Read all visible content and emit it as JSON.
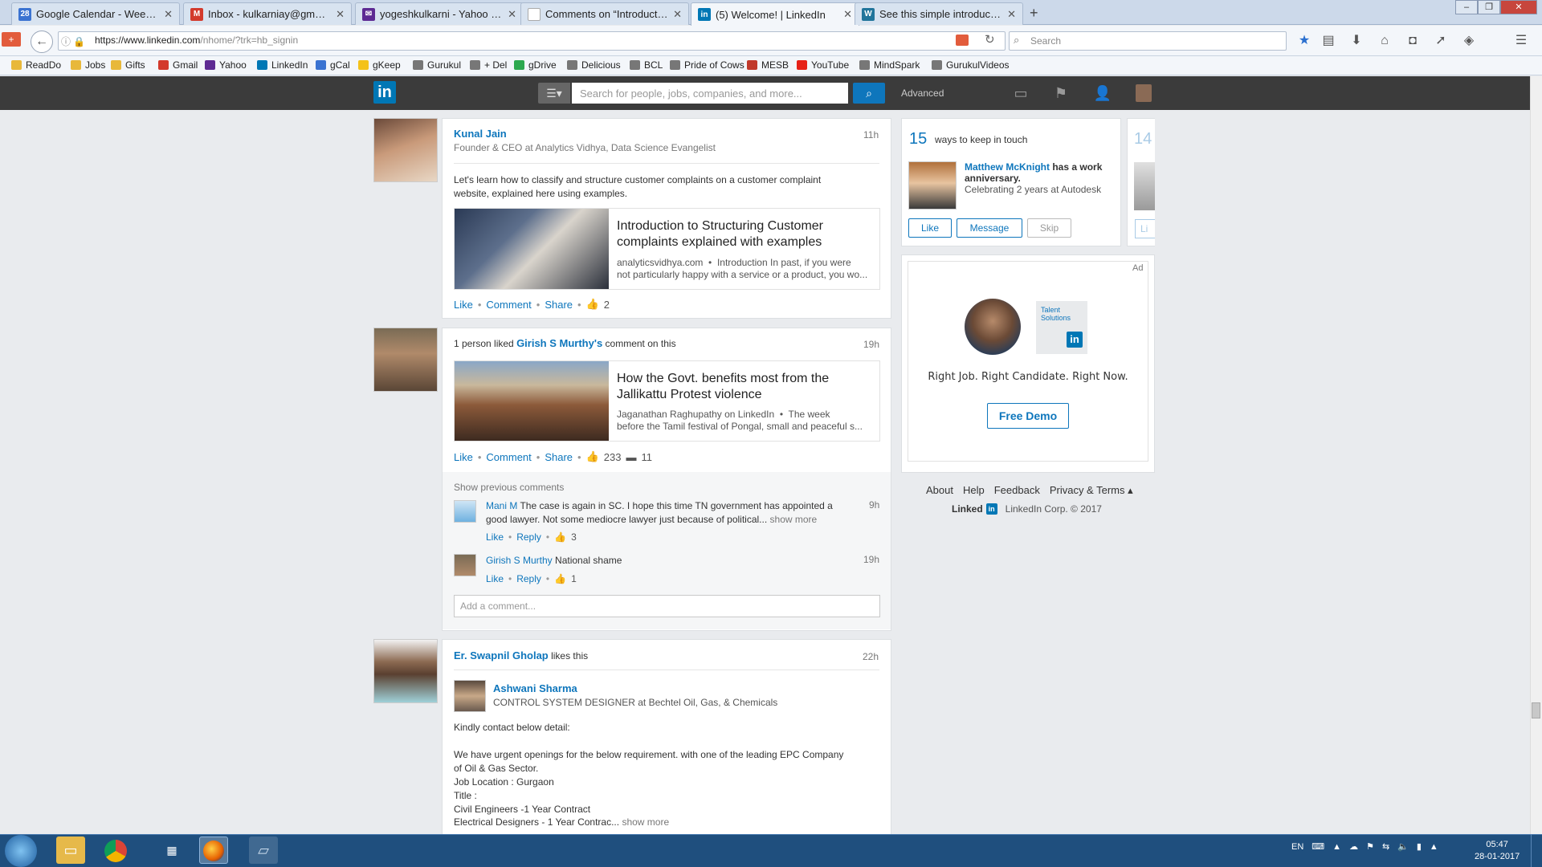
{
  "browser": {
    "tabs": [
      {
        "title": "Google Calendar - Week of...",
        "icon": "calendar-icon",
        "color": "#3b73d1",
        "glyph": "28"
      },
      {
        "title": "Inbox - kulkarniay@gmail....",
        "icon": "gmail-icon",
        "color": "#d33a2c",
        "glyph": "M"
      },
      {
        "title": "yogeshkulkarni - Yahoo Mail",
        "icon": "yahoo-icon",
        "color": "#5d2a93",
        "glyph": "✉"
      },
      {
        "title": "Comments on “Introduction to...",
        "icon": "blank-page-icon",
        "color": "#ffffff",
        "glyph": ""
      },
      {
        "title": "(5) Welcome! | LinkedIn",
        "icon": "linkedin-icon",
        "color": "#0077b5",
        "glyph": "in"
      },
      {
        "title": "See this simple introductio...",
        "icon": "wordpress-icon",
        "color": "#21759b",
        "glyph": "W"
      }
    ],
    "url_host": "https://www.linkedin.com",
    "url_path": "/nhome/?trk=hb_signin",
    "search_placeholder": "Search",
    "bookmarks": [
      {
        "label": "ReadDo",
        "icon": "folder-icon",
        "color": "#e8b83a"
      },
      {
        "label": "Jobs",
        "icon": "folder-icon",
        "color": "#e8b83a"
      },
      {
        "label": "Gifts",
        "icon": "folder-icon",
        "color": "#e8b83a"
      },
      {
        "label": "Gmail",
        "icon": "gmail-icon",
        "color": "#d33a2c"
      },
      {
        "label": "Yahoo",
        "icon": "yahoo-icon",
        "color": "#5d2a93"
      },
      {
        "label": "LinkedIn",
        "icon": "linkedin-icon",
        "color": "#0077b5"
      },
      {
        "label": "gCal",
        "icon": "calendar-icon",
        "color": "#3b73d1"
      },
      {
        "label": "gKeep",
        "icon": "keep-icon",
        "color": "#f4c21a"
      },
      {
        "label": "Gurukul",
        "icon": "globe-icon",
        "color": "#777777"
      },
      {
        "label": "+ Del",
        "icon": "globe-icon",
        "color": "#777777"
      },
      {
        "label": "gDrive",
        "icon": "drive-icon",
        "color": "#2da94f"
      },
      {
        "label": "Delicious",
        "icon": "globe-icon",
        "color": "#777777"
      },
      {
        "label": "BCL",
        "icon": "globe-icon",
        "color": "#777777"
      },
      {
        "label": "Pride of Cows",
        "icon": "globe-icon",
        "color": "#777777"
      },
      {
        "label": "MESB",
        "icon": "mesb-icon",
        "color": "#c0392b"
      },
      {
        "label": "YouTube",
        "icon": "youtube-icon",
        "color": "#e62117"
      },
      {
        "label": "MindSpark",
        "icon": "globe-icon",
        "color": "#777777"
      },
      {
        "label": "GurukulVideos",
        "icon": "globe-icon",
        "color": "#777777"
      }
    ]
  },
  "linkedin": {
    "search_placeholder": "Search for people, jobs, companies, and more...",
    "advanced_label": "Advanced",
    "brand_color": "#0077b5",
    "feed": {
      "post1": {
        "author": "Kunal Jain",
        "headline": "Founder & CEO at Analytics Vidhya, Data Science Evangelist",
        "time": "11h",
        "text_line1": "Let's learn how to classify and structure customer complaints on a customer complaint",
        "text_line2": "website, explained here using examples.",
        "article_title_line1": "Introduction to Structuring Customer",
        "article_title_line2": "complaints explained with examples",
        "article_domain": "analyticsvidhya.com",
        "article_snippet_line1": "Introduction In past, if you were",
        "article_snippet_line2": "not particularly happy with a service or a product, you wo...",
        "like": "Like",
        "comment": "Comment",
        "share": "Share",
        "likes_count": "2"
      },
      "post2": {
        "activity_prefix": "1 person liked",
        "activity_name": "Girish S Murthy's",
        "activity_suffix": "comment on this",
        "time": "19h",
        "article_title_line1": "How the Govt. benefits most from the",
        "article_title_line2": "Jallikattu Protest violence",
        "article_source": "Jaganathan Raghupathy on LinkedIn",
        "article_snippet_line1": "The week",
        "article_snippet_line2": "before the Tamil festival of Pongal, small and peaceful s...",
        "like": "Like",
        "comment": "Comment",
        "share": "Share",
        "likes_count": "233",
        "comments_count": "11",
        "show_previous": "Show previous comments",
        "comments": [
          {
            "name": "Mani M",
            "text_line1": "The case is again in SC. I hope this time TN government has appointed a",
            "text_line2": "good lawyer. Not some mediocre lawyer just because of political...",
            "more": "show more",
            "time": "9h",
            "like": "Like",
            "reply": "Reply",
            "likes": "3"
          },
          {
            "name": "Girish S Murthy",
            "text_line1": "National shame",
            "time": "19h",
            "like": "Like",
            "reply": "Reply",
            "likes": "1"
          }
        ],
        "add_comment_placeholder": "Add a comment..."
      },
      "post3": {
        "actor": "Er. Swapnil Gholap",
        "action": "likes this",
        "time": "22h",
        "author": "Ashwani Sharma",
        "headline": "CONTROL SYSTEM DESIGNER at Bechtel Oil, Gas, & Chemicals",
        "lines": [
          "Kindly contact below detail:",
          "",
          "We have urgent openings for the below requirement. with one of the leading EPC Company",
          "of Oil & Gas Sector.",
          "Job Location : Gurgaon",
          "Title :",
          "Civil Engineers -1 Year Contract"
        ],
        "last_line": "Electrical Designers - 1 Year Contrac...",
        "more": "show more"
      }
    },
    "keep_in_touch": {
      "count": "15",
      "label": "ways to keep in touch",
      "next_count": "14",
      "person": "Matthew McKnight",
      "event": "has a work anniversary.",
      "detail": "Celebrating 2 years at Autodesk",
      "like": "Like",
      "message": "Message",
      "skip": "Skip",
      "peek_button": "Li"
    },
    "ad": {
      "tag": "Ad",
      "badge_text_line1": "Talent",
      "badge_text_line2": "Solutions",
      "tagline": "Right Job. Right Candidate. Right Now.",
      "cta": "Free Demo"
    },
    "footer": {
      "links": [
        "About",
        "Help",
        "Feedback",
        "Privacy & Terms"
      ],
      "brand": "Linked",
      "copyright": "LinkedIn Corp. © 2017"
    }
  },
  "taskbar": {
    "language": "EN",
    "time": "05:47",
    "date": "28-01-2017"
  }
}
